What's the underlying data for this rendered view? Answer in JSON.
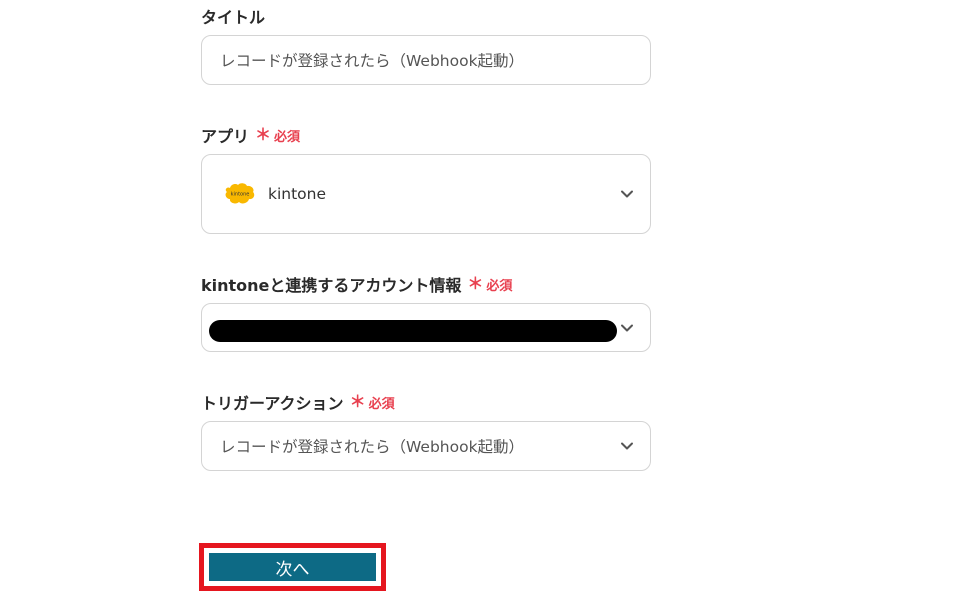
{
  "form": {
    "title": {
      "label": "タイトル",
      "value": "レコードが登録されたら（Webhook起動）"
    },
    "app": {
      "label": "アプリ",
      "required_mark": "＊",
      "required_text": "必須",
      "selected": "kintone",
      "logo_text": "kintone",
      "icon": "chevron-down-icon"
    },
    "account": {
      "label": "kintoneと連携するアカウント情報",
      "required_mark": "＊",
      "required_text": "必須",
      "icon": "chevron-down-icon"
    },
    "trigger": {
      "label": "トリガーアクション",
      "required_mark": "＊",
      "required_text": "必須",
      "selected": "レコードが登録されたら（Webhook起動）",
      "icon": "chevron-down-icon"
    }
  },
  "next_button": {
    "label": "次へ"
  },
  "colors": {
    "accent": "#0d6a85",
    "required": "#e8404f",
    "highlight_border": "#e5161f",
    "kintone_yellow": "#f9b800"
  }
}
